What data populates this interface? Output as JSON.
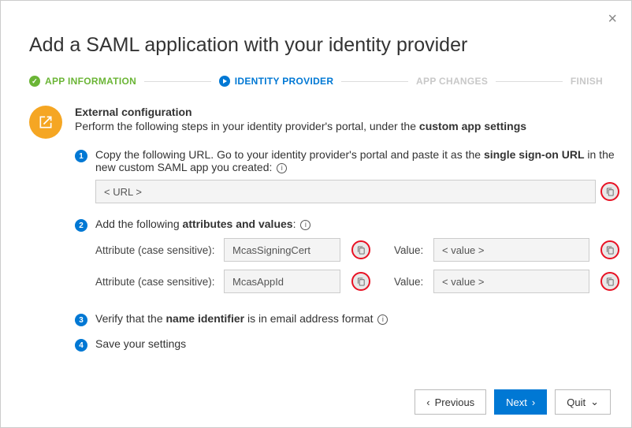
{
  "close_label": "×",
  "title": "Add a SAML application with your identity provider",
  "steps": {
    "s1": "APP INFORMATION",
    "s2": "IDENTITY PROVIDER",
    "s3": "APP CHANGES",
    "s4": "FINISH"
  },
  "section": {
    "title": "External configuration",
    "desc_pre": "Perform the following steps in your identity provider's portal, under the ",
    "desc_bold": "custom app settings"
  },
  "inst1": {
    "num": "1",
    "text_pre": "Copy the following URL. Go to your identity provider's portal and paste it as the ",
    "text_bold": "single sign-on URL",
    "text_post": " in the new custom SAML app you created: ",
    "url_value": "< URL >"
  },
  "inst2": {
    "num": "2",
    "text_pre": "Add the following ",
    "text_bold": "attributes and values",
    "text_post": ": ",
    "attr_label": "Attribute (case sensitive):",
    "val_label": "Value:",
    "rows": [
      {
        "attr": "McasSigningCert",
        "val": "< value >"
      },
      {
        "attr": "McasAppId",
        "val": "< value >"
      }
    ]
  },
  "inst3": {
    "num": "3",
    "text_pre": "Verify that the ",
    "text_bold": "name identifier",
    "text_post": " is in email address format "
  },
  "inst4": {
    "num": "4",
    "text": "Save your settings"
  },
  "footer": {
    "prev_chev": "‹",
    "prev": "Previous",
    "next": "Next",
    "next_chev": "›",
    "quit": "Quit",
    "quit_chev": "⌄"
  }
}
